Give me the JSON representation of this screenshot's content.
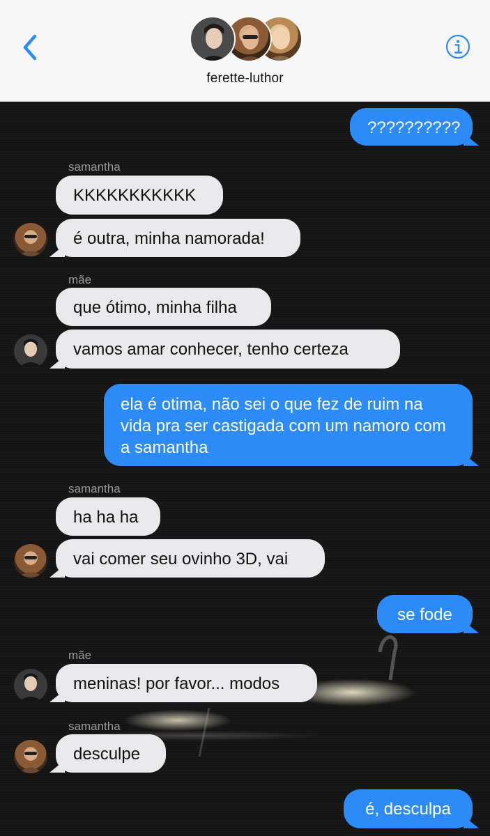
{
  "header": {
    "group_name": "ferette-luthor",
    "back_icon": "chevron-left-icon",
    "info_icon": "info-icon",
    "accent_color": "#2c8bf6"
  },
  "messages": [
    {
      "from": "me",
      "text": "??????????"
    },
    {
      "sender": "samantha",
      "text": "KKKKKKKKKKK"
    },
    {
      "sender": "samantha",
      "text": "é outra, minha namorada!"
    },
    {
      "sender": "mãe",
      "text": "que ótimo, minha filha"
    },
    {
      "sender": "mãe",
      "text": "vamos amar conhecer, tenho certeza"
    },
    {
      "from": "me",
      "text": "ela é otima, não sei o que fez de ruim na vida pra ser castigada com um namoro com a samantha"
    },
    {
      "sender": "samantha",
      "text": "ha ha ha"
    },
    {
      "sender": "samantha",
      "text": "vai comer seu ovinho 3D, vai"
    },
    {
      "from": "me",
      "text": "se fode"
    },
    {
      "sender": "mãe",
      "text": "meninas! por favor... modos"
    },
    {
      "sender": "samantha",
      "text": "desculpe"
    },
    {
      "from": "me",
      "text": "é, desculpa"
    }
  ]
}
